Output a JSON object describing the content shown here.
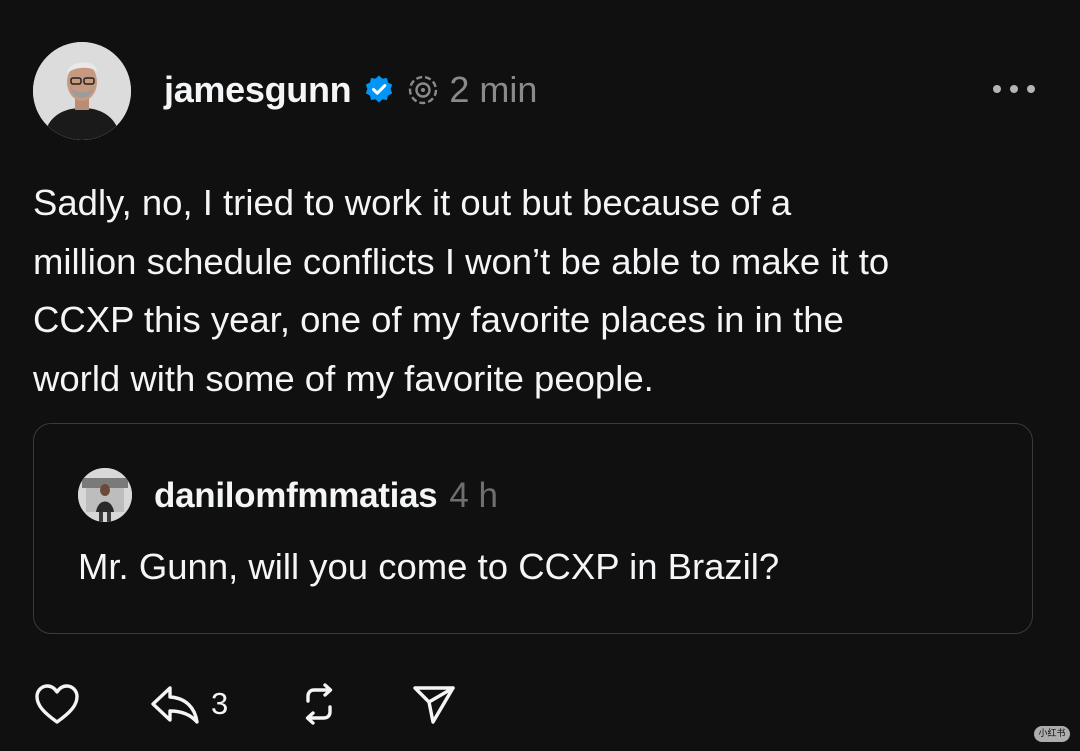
{
  "post": {
    "author": {
      "username": "jamesgunn",
      "verified": true
    },
    "timestamp": "2 min",
    "text": "Sadly, no, I tried to work it out but because of a\nmillion schedule conflicts I won’t be able to make it to\nCCXP this year, one of my favorite places in in the\nworld with some of my favorite people.",
    "quoted": {
      "username": "danilomfmmatias",
      "timestamp": "4 h",
      "text": "Mr. Gunn, will you come to CCXP in Brazil?"
    },
    "actions": {
      "like_icon": "heart-icon",
      "reply_icon": "reply-arrow-icon",
      "reply_count": "3",
      "repost_icon": "repost-icon",
      "share_icon": "send-icon"
    }
  },
  "watermark": "小红书",
  "colors": {
    "background": "#101010",
    "text_primary": "#f3f5f7",
    "text_secondary": "#8a8a8a",
    "verified_blue": "#0095f6",
    "card_border": "#3a3a3a"
  }
}
